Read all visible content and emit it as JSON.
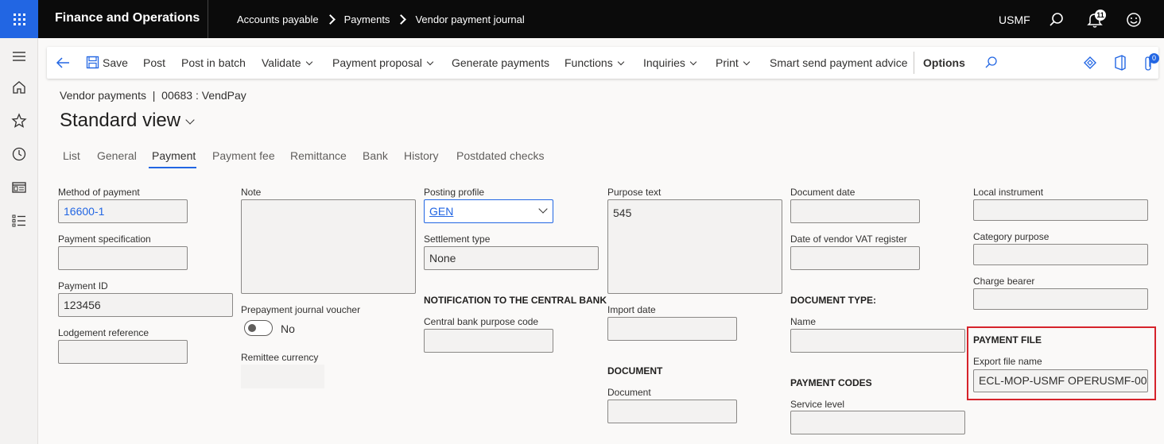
{
  "topbar": {
    "app_title": "Finance and Operations",
    "breadcrumb": [
      "Accounts payable",
      "Payments",
      "Vendor payment journal"
    ],
    "company": "USMF",
    "notification_count": "11"
  },
  "actionbar": {
    "save": "Save",
    "post": "Post",
    "post_in_batch": "Post in batch",
    "validate": "Validate",
    "payment_proposal": "Payment proposal",
    "generate_payments": "Generate payments",
    "functions": "Functions",
    "inquiries": "Inquiries",
    "print": "Print",
    "smart_send": "Smart send payment advice",
    "options": "Options",
    "attachment_count": "0"
  },
  "page": {
    "caption": "Vendor payments  |  00683 : VendPay",
    "title": "Standard view"
  },
  "tabs": [
    "List",
    "General",
    "Payment",
    "Payment fee",
    "Remittance",
    "Bank",
    "History",
    "Postdated checks"
  ],
  "active_tab": "Payment",
  "form": {
    "method_of_payment": {
      "label": "Method of payment",
      "value": "16600-1"
    },
    "payment_specification": {
      "label": "Payment specification",
      "value": ""
    },
    "payment_id": {
      "label": "Payment ID",
      "value": "123456"
    },
    "lodgement_reference": {
      "label": "Lodgement reference",
      "value": ""
    },
    "note": {
      "label": "Note",
      "value": ""
    },
    "prepayment_journal_voucher": {
      "label": "Prepayment journal voucher",
      "value": "No"
    },
    "remittee_currency": {
      "label": "Remittee currency",
      "value": ""
    },
    "posting_profile": {
      "label": "Posting profile",
      "value": "GEN"
    },
    "settlement_type": {
      "label": "Settlement type",
      "value": "None"
    },
    "central_bank_section": "NOTIFICATION TO THE CENTRAL BANK",
    "central_bank_purpose_code": {
      "label": "Central bank purpose code",
      "value": ""
    },
    "purpose_text": {
      "label": "Purpose text",
      "value": "545"
    },
    "import_date": {
      "label": "Import date",
      "value": ""
    },
    "document_section": "DOCUMENT",
    "document": {
      "label": "Document",
      "value": ""
    },
    "document_date": {
      "label": "Document date",
      "value": ""
    },
    "date_of_vendor_vat_register": {
      "label": "Date of vendor VAT register",
      "value": ""
    },
    "document_type_section": "DOCUMENT TYPE:",
    "name": {
      "label": "Name",
      "value": ""
    },
    "payment_codes_section": "PAYMENT CODES",
    "service_level": {
      "label": "Service level",
      "value": ""
    },
    "local_instrument": {
      "label": "Local instrument",
      "value": ""
    },
    "category_purpose": {
      "label": "Category purpose",
      "value": ""
    },
    "charge_bearer": {
      "label": "Charge bearer",
      "value": ""
    },
    "payment_file_section": "PAYMENT FILE",
    "export_file_name": {
      "label": "Export file name",
      "value": "ECL-MOP-USMF OPERUSMF-00..."
    }
  },
  "colors": {
    "accent": "#2266e3",
    "highlight": "#d6232b",
    "topbar": "#0b0b0b"
  }
}
